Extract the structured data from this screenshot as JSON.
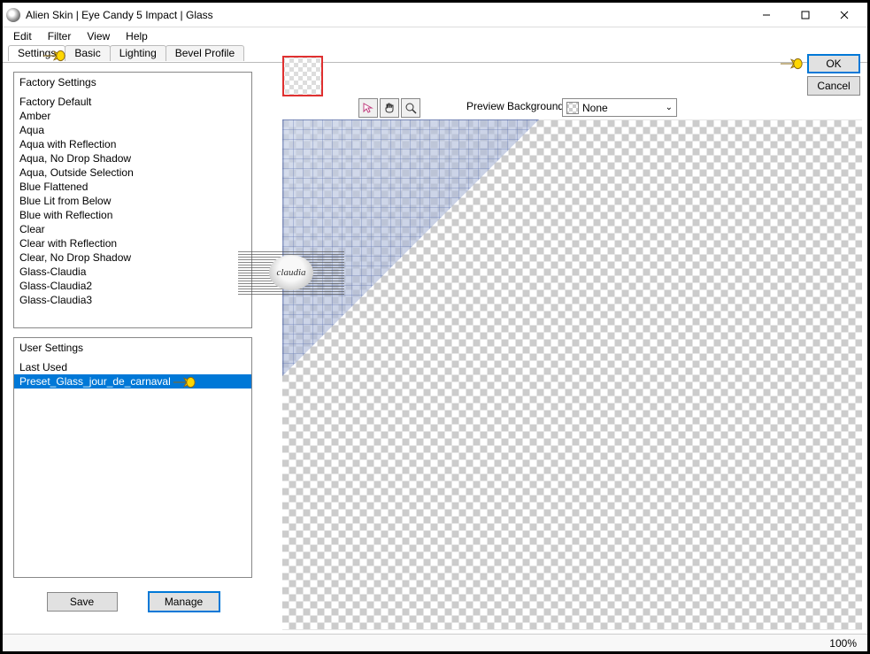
{
  "window": {
    "title": "Alien Skin | Eye Candy 5 Impact | Glass"
  },
  "menu": {
    "items": [
      "Edit",
      "Filter",
      "View",
      "Help"
    ]
  },
  "tabs": {
    "items": [
      "Settings",
      "Basic",
      "Lighting",
      "Bevel Profile"
    ],
    "active": 0
  },
  "factory": {
    "header": "Factory Settings",
    "items": [
      "Factory Default",
      "Amber",
      "Aqua",
      "Aqua with Reflection",
      "Aqua, No Drop Shadow",
      "Aqua, Outside Selection",
      "Blue Flattened",
      "Blue Lit from Below",
      "Blue with Reflection",
      "Clear",
      "Clear with Reflection",
      "Clear, No Drop Shadow",
      "Glass-Claudia",
      "Glass-Claudia2",
      "Glass-Claudia3"
    ]
  },
  "user": {
    "header": "User Settings",
    "items": [
      {
        "label": "Last Used",
        "selected": false
      },
      {
        "label": "Preset_Glass_jour_de_carnaval",
        "selected": true
      }
    ]
  },
  "buttons": {
    "save": "Save",
    "manage": "Manage",
    "ok": "OK",
    "cancel": "Cancel"
  },
  "preview": {
    "label": "Preview Background:",
    "selected": "None"
  },
  "watermark": "claudia",
  "status": {
    "zoom": "100%"
  }
}
